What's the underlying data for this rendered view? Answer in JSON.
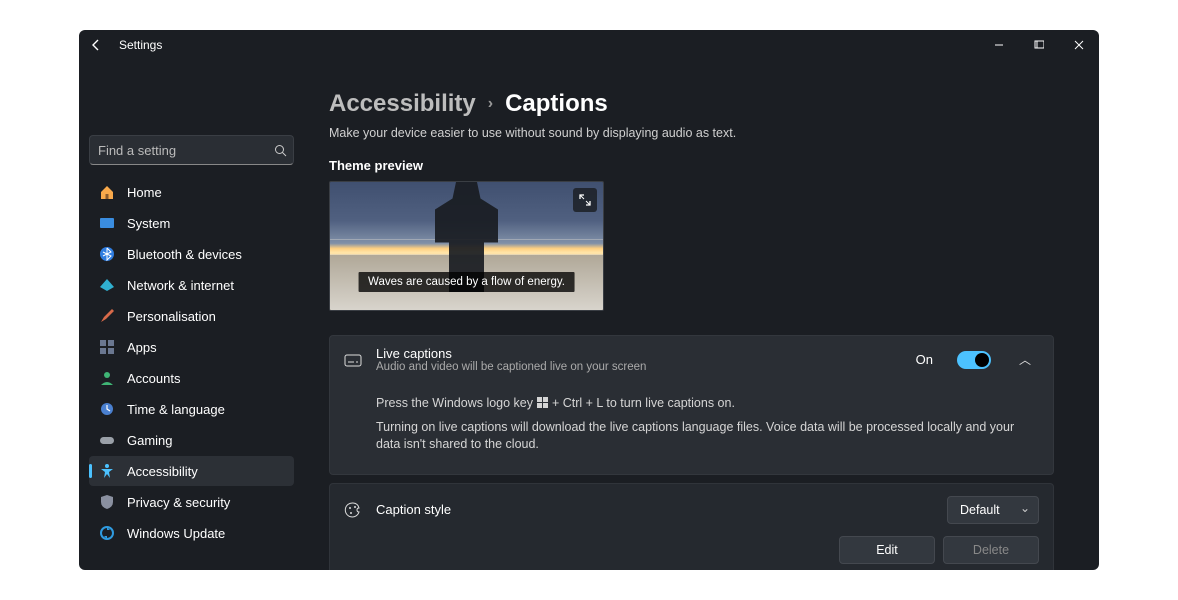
{
  "titlebar": {
    "app_name": "Settings"
  },
  "search": {
    "placeholder": "Find a setting"
  },
  "sidebar": {
    "items": [
      {
        "label": "Home"
      },
      {
        "label": "System"
      },
      {
        "label": "Bluetooth & devices"
      },
      {
        "label": "Network & internet"
      },
      {
        "label": "Personalisation"
      },
      {
        "label": "Apps"
      },
      {
        "label": "Accounts"
      },
      {
        "label": "Time & language"
      },
      {
        "label": "Gaming"
      },
      {
        "label": "Accessibility"
      },
      {
        "label": "Privacy & security"
      },
      {
        "label": "Windows Update"
      }
    ]
  },
  "page": {
    "breadcrumb_parent": "Accessibility",
    "breadcrumb_current": "Captions",
    "description": "Make your device easier to use without sound by displaying audio as text.",
    "theme_preview_label": "Theme preview",
    "preview_caption": "Waves are caused by a flow of energy.",
    "live_captions": {
      "title": "Live captions",
      "subtitle": "Audio and video will be captioned live on your screen",
      "state": "On",
      "tip_pre": "Press the Windows logo key ",
      "tip_post": " + Ctrl + L to turn live captions on.",
      "note": "Turning on live captions will download the live captions language files. Voice data will be processed locally and your data isn't shared to the cloud."
    },
    "caption_style": {
      "title": "Caption style",
      "selected": "Default",
      "edit": "Edit",
      "delete": "Delete"
    }
  }
}
